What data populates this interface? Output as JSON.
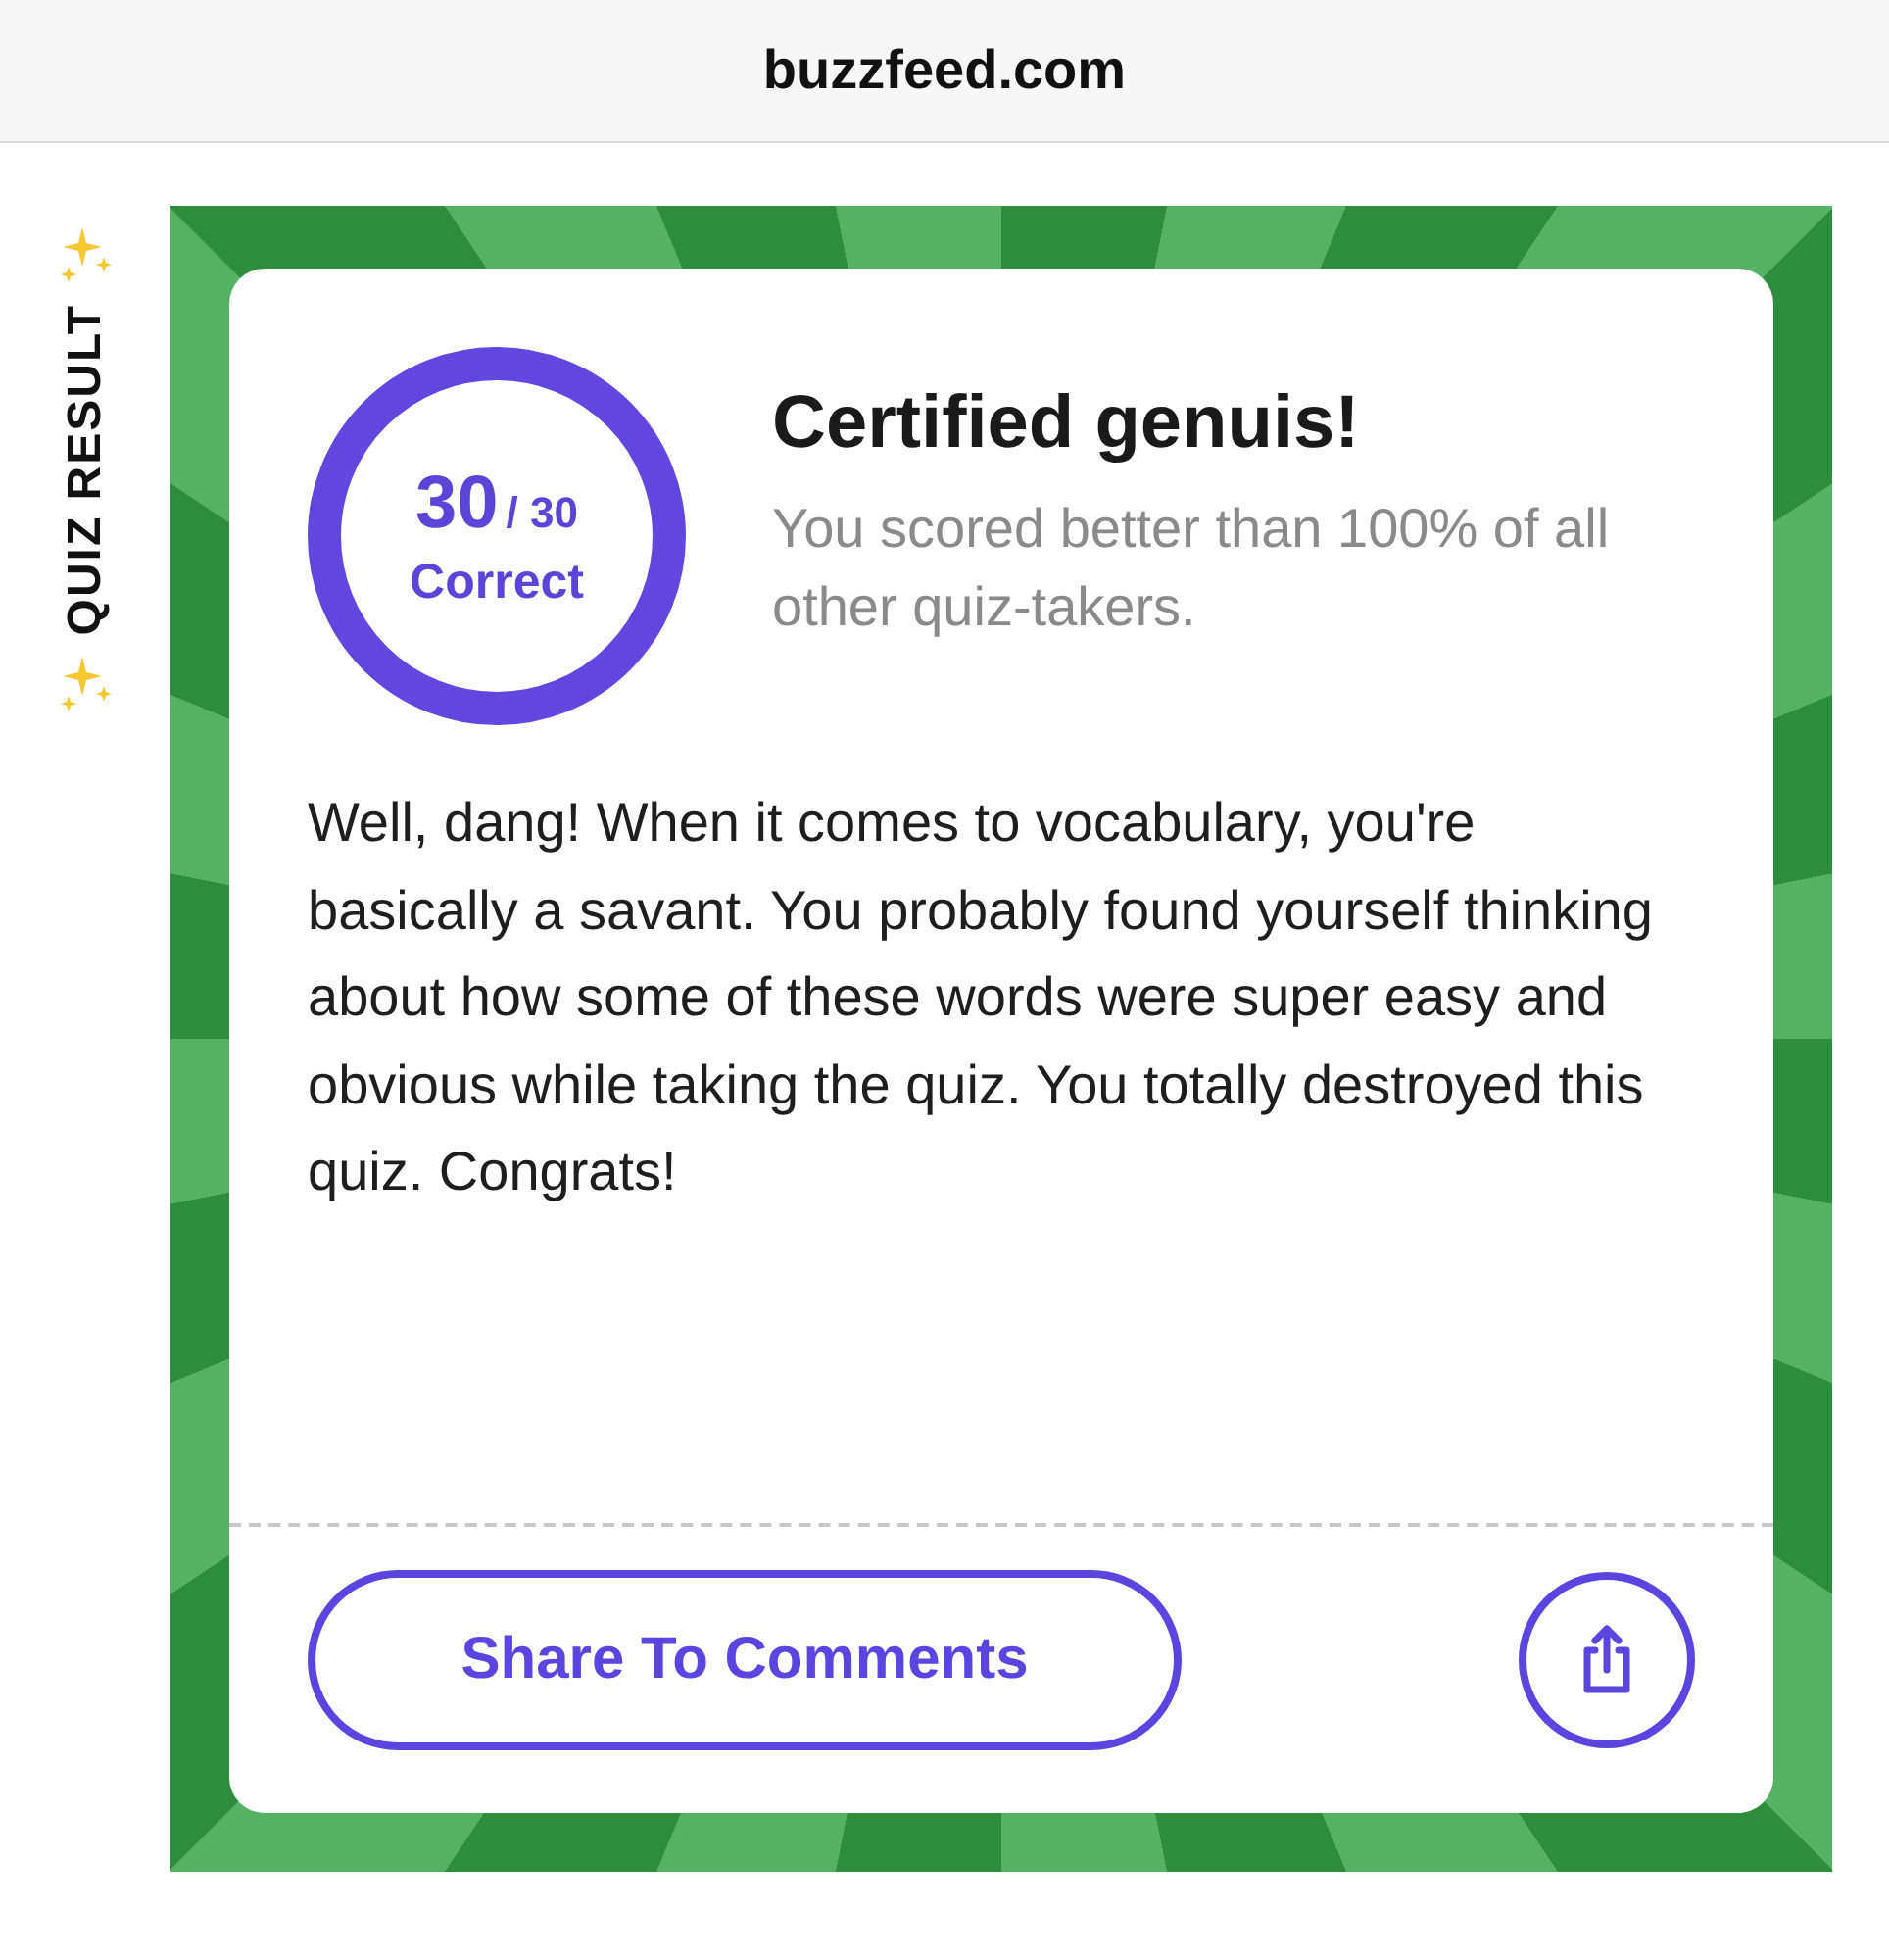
{
  "address_bar": {
    "url": "buzzfeed.com"
  },
  "side_label": "QUIZ RESULT",
  "result": {
    "score": "30",
    "total": "/ 30",
    "score_label": "Correct",
    "title": "Certified genuis!",
    "subtitle": "You scored better than 100% of all other quiz-takers.",
    "description": "Well, dang! When it comes to vocabulary, you're basically a savant. You probably found yourself thinking about how some of these words were super easy and obvious while taking the quiz. You totally destroyed this quiz. Congrats!"
  },
  "buttons": {
    "share_comments": "Share To Comments"
  }
}
